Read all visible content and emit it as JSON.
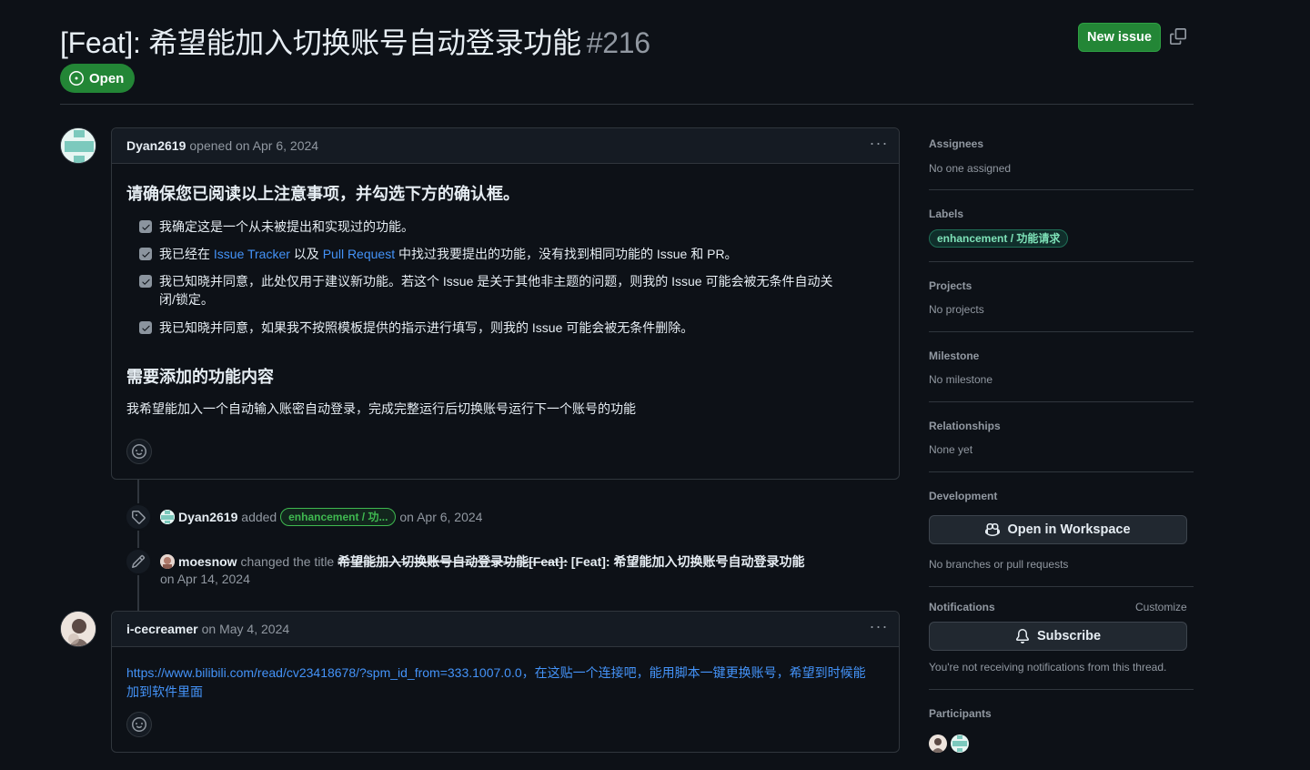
{
  "issue": {
    "title": "[Feat]: 希望能加入切换账号自动登录功能",
    "number": "#216",
    "state": "Open",
    "new_issue_label": "New issue"
  },
  "first_comment": {
    "author": "Dyan2619",
    "meta": "opened on Apr 6, 2024",
    "heading1": "请确保您已阅读以上注意事项，并勾选下方的确认框。",
    "tasks": [
      {
        "text": "我确定这是一个从未被提出和实现过的功能。"
      },
      {
        "pre": "我已经在 ",
        "link1": "Issue Tracker",
        "mid": " 以及 ",
        "link2": "Pull Request",
        "post": " 中找过我要提出的功能，没有找到相同功能的 Issue 和 PR。"
      },
      {
        "text_line1": "我已知晓并同意，此处仅用于建议新功能。若这个 Issue 是关于其他非主题的问题，则我的 Issue 可能会被无条件自动关",
        "text_line2": "闭/锁定。"
      },
      {
        "text": "我已知晓并同意，如果我不按照模板提供的指示进行填写，则我的 Issue 可能会被无条件删除。"
      }
    ],
    "heading2": "需要添加的功能内容",
    "content": "我希望能加入一个自动输入账密自动登录，完成完整运行后切换账号运行下一个账号的功能"
  },
  "events": [
    {
      "author": "Dyan2619",
      "action": "added",
      "label": "enhancement / 功...",
      "date": "on Apr 6, 2024"
    },
    {
      "author": "moesnow",
      "action": "changed the title",
      "old_title": "希望能加入切换账号自动登录功能[Feat]:",
      "new_title": "[Feat]: 希望能加入切换账号自动登录功能",
      "date": "on Apr 14, 2024"
    }
  ],
  "second_comment": {
    "author": "i-cecreamer",
    "meta": "on May 4, 2024",
    "link_line1": "https://www.bilibili.com/read/cv23418678/?spm_id_from=333.1007.0.0，在这贴一个连接吧，能用脚本一键更换账号，希望到时候能",
    "link_line2": "加到软件里面"
  },
  "sidebar": {
    "assignees": {
      "heading": "Assignees",
      "value": "No one assigned"
    },
    "labels": {
      "heading": "Labels",
      "label": "enhancement / 功能请求"
    },
    "projects": {
      "heading": "Projects",
      "value": "No projects"
    },
    "milestone": {
      "heading": "Milestone",
      "value": "No milestone"
    },
    "relationships": {
      "heading": "Relationships",
      "value": "None yet"
    },
    "development": {
      "heading": "Development",
      "button": "Open in Workspace",
      "value": "No branches or pull requests"
    },
    "notifications": {
      "heading": "Notifications",
      "customize": "Customize",
      "button": "Subscribe",
      "value": "You're not receiving notifications from this thread."
    },
    "participants": {
      "heading": "Participants"
    }
  },
  "colors": {
    "accent_green": "#238636",
    "link": "#4493f8",
    "background": "#0d1117",
    "border": "#30363d"
  }
}
